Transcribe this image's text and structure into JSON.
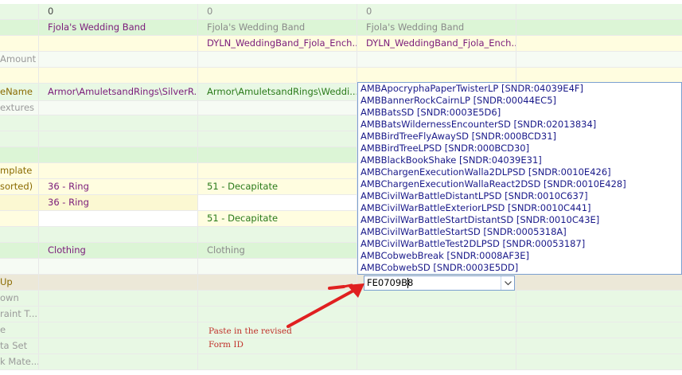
{
  "rows": [
    {
      "label": "",
      "c1": "0",
      "c2": "0",
      "c3": "0",
      "c4": ""
    },
    {
      "label": "",
      "c1": "Fjola's Wedding Band",
      "c2": "Fjola's Wedding Band",
      "c3": "Fjola's Wedding Band",
      "c4": ""
    },
    {
      "label": "",
      "c1": "",
      "c2": "DYLN_WeddingBand_Fjola_Ench...",
      "c3": "DYLN_WeddingBand_Fjola_Ench...",
      "c4": ""
    },
    {
      "label": "Amount",
      "c1": "",
      "c2": "",
      "c3": "",
      "c4": ""
    },
    {
      "label": "",
      "c1": "",
      "c2": "",
      "c3": "",
      "c4": ""
    },
    {
      "label": "eName",
      "c1": "Armor\\AmuletsandRings\\SilverR...",
      "c2": "Armor\\AmuletsandRings\\Weddi...",
      "c3": "",
      "c4": ""
    },
    {
      "label": "extures",
      "c1": "",
      "c2": "",
      "c3": "",
      "c4": ""
    },
    {
      "label": "",
      "c1": "",
      "c2": "",
      "c3": "",
      "c4": ""
    },
    {
      "label": "",
      "c1": "",
      "c2": "",
      "c3": "",
      "c4": ""
    },
    {
      "label": "",
      "c1": "",
      "c2": "",
      "c3": "",
      "c4": ""
    },
    {
      "label": "mplate",
      "c1": "",
      "c2": "",
      "c3": "",
      "c4": ""
    },
    {
      "label": "sorted)",
      "c1": "36 - Ring",
      "c2": "51 - Decapitate",
      "c3": "",
      "c4": ""
    },
    {
      "label": "",
      "c1": "36 - Ring",
      "c2": "",
      "c3": "",
      "c4": ""
    },
    {
      "label": "",
      "c1": "",
      "c2": "51 - Decapitate",
      "c3": "",
      "c4": ""
    },
    {
      "label": "",
      "c1": "",
      "c2": "",
      "c3": "",
      "c4": ""
    },
    {
      "label": "",
      "c1": "Clothing",
      "c2": "Clothing",
      "c3": "",
      "c4": ""
    },
    {
      "label": "",
      "c1": "",
      "c2": "",
      "c3": "",
      "c4": ""
    },
    {
      "label": "Up",
      "c1": "",
      "c2": "",
      "c3": "",
      "c4": ""
    },
    {
      "label": "own",
      "c1": "",
      "c2": "",
      "c3": "",
      "c4": ""
    },
    {
      "label": "raint T...",
      "c1": "",
      "c2": "",
      "c3": "",
      "c4": ""
    },
    {
      "label": "e",
      "c1": "",
      "c2": "",
      "c3": "",
      "c4": ""
    },
    {
      "label": "ta Set",
      "c1": "",
      "c2": "",
      "c3": "",
      "c4": ""
    },
    {
      "label": "k Mate...",
      "c1": "",
      "c2": "",
      "c3": "",
      "c4": ""
    }
  ],
  "dropdown": {
    "items": [
      "AMBApocryphaPaperTwisterLP [SNDR:04039E4F]",
      "AMBBannerRockCairnLP [SNDR:00044EC5]",
      "AMBBatsSD [SNDR:0003E5D6]",
      "AMBBatsWildernessEncounterSD [SNDR:02013834]",
      "AMBBirdTreeFlyAwaySD [SNDR:000BCD31]",
      "AMBBirdTreeLPSD [SNDR:000BCD30]",
      "AMBBlackBookShake [SNDR:04039E31]",
      "AMBChargenExecutionWalla2DLPSD [SNDR:0010E426]",
      "AMBChargenExecutionWallaReact2DSD [SNDR:0010E428]",
      "AMBCivilWarBattleDistantLPSD [SNDR:0010C637]",
      "AMBCivilWarBattleExteriorLPSD [SNDR:0010C441]",
      "AMBCivilWarBattleStartDistantSD [SNDR:0010C43E]",
      "AMBCivilWarBattleStartSD [SNDR:0005318A]",
      "AMBCivilWarBattleTest2DLPSD [SNDR:00053187]",
      "AMBCobwebBreak [SNDR:0008AF3E]",
      "AMBCobwebSD [SNDR:0003E5DD]"
    ]
  },
  "combo": {
    "value": "FE0709B8"
  },
  "annotation": {
    "line1": "Paste in the revised",
    "line2": "Form ID"
  },
  "colors": {
    "arrow": "#e02020",
    "note": "#c0302a",
    "dropdown_border": "#7a9fd0"
  },
  "icons": {
    "combo_button": "chevron-down-icon",
    "arrow": "red-arrow-icon"
  }
}
